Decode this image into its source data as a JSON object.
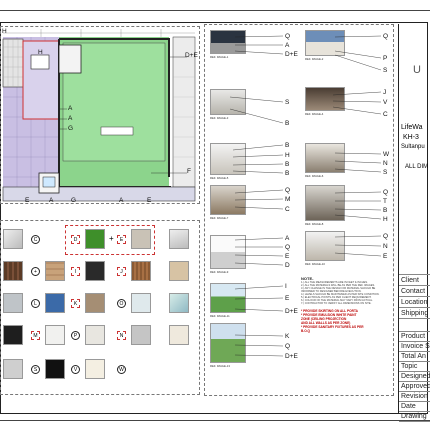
{
  "plan": {
    "callouts_right": [
      "D+E",
      "A",
      "A",
      "G",
      "F"
    ],
    "callouts_left": [
      "H",
      "H",
      "A"
    ],
    "callouts_bottom": [
      "E",
      "A",
      "G",
      "A",
      "E"
    ],
    "room_label": "F"
  },
  "swatches": {
    "circle_tags": [
      "C",
      "L",
      "O",
      "T",
      "P",
      "S",
      "V",
      "W"
    ],
    "square_tags": [
      "D",
      "E",
      "I",
      "J",
      "K",
      "M",
      "N",
      "Q",
      "R",
      "U"
    ],
    "plus": "+"
  },
  "refs": {
    "captions": [
      "REF. IMAGE-1",
      "REF. IMAGE-2",
      "REF. IMAGE-3",
      "REF. IMAGE-4",
      "REF. IMAGE-5",
      "REF. IMAGE-6",
      "REF. IMAGE-7",
      "REF. IMAGE-8",
      "REF. IMAGE-9",
      "REF. IMAGE-10",
      "REF. IMAGE-11",
      "REF. IMAGE-12",
      "REF. IMAGE-13",
      "REF. IMAGE-14"
    ],
    "left_tags": [
      [
        "Q",
        "A",
        "D+E"
      ],
      [
        "S",
        "B"
      ],
      [
        "B",
        "H",
        "B",
        "B"
      ],
      [
        "Q",
        "M",
        "C"
      ],
      [
        "A",
        "Q",
        "E",
        "D"
      ],
      [
        "I",
        "E",
        "D+E"
      ],
      [
        "K",
        "Q",
        "D+E"
      ]
    ],
    "right_tags": [
      [
        "Q",
        "P",
        "S"
      ],
      [
        "J",
        "V",
        "C"
      ],
      [
        "W",
        "N",
        "S"
      ],
      [
        "Q",
        "T",
        "B",
        "H"
      ],
      [
        "Q",
        "N",
        "E"
      ]
    ]
  },
  "notes": {
    "heading": "NOTE-",
    "lines": [
      "1.) ALL THE MEASUREMENTS ARE IN FEET & INCHES.",
      "2.) ALL THE MATERIALS WILL BE AS PER THE REF. IMAGES.",
      "3.) ANY CHANGE IN THE DESIGN OR MATERIAL SHOULD BE",
      "    INFORMED TO DESIGNER BEFORE EXECUTION.",
      "4.) LEVELS SHOULD BE MAINTAINED AS PER SITE CONDITION.",
      "5.) ELECTRICAL POINTS AS PER CLIENT REQUIREMENT.",
      "6.) COLOUR OF THE MATERIAL MAY VARY FROM ACTUAL.",
      "7.) CONTRACTOR TO VERIFY ALL DIMENSIONS ON SITE."
    ],
    "red_lines": [
      "* PROVIDE SKIRTING ON ALL PORTA",
      "* PROVIDE EMULSION WHITE PAINT",
      "  ZONE (CEILING PROJECTION",
      "  AND ALL WALLS AS PER ZONE)",
      "* PROVIDE SANITARY FIXTURES AS PER",
      "  B.O.Q"
    ]
  },
  "title_block": {
    "logo": "U",
    "company_line1": "LifeWa",
    "company_line2": "KH-3",
    "company_line3": "Sultanpu",
    "dim_note": "ALL DIM",
    "rows": [
      "Client",
      "Contact",
      "Location",
      "Shipping"
    ],
    "rows2": [
      "Product",
      "Invoice S",
      "Total An",
      "Topic",
      "Designed",
      "Approved",
      "Revision",
      "Date",
      "Drawing"
    ]
  },
  "colors": {
    "grass": "#8cd48c",
    "lavender": "#c9bfe3",
    "wall": "#222222",
    "red_outline": "#d03030",
    "sky_dark": "#2a3340"
  }
}
